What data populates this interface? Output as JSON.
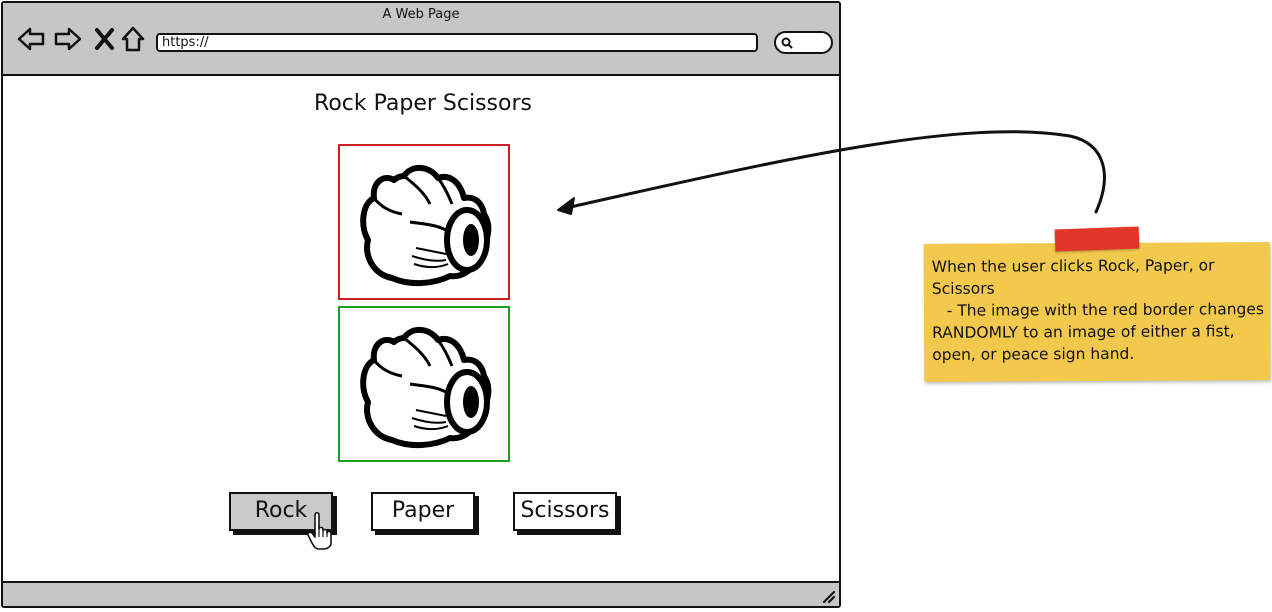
{
  "browser": {
    "window_title": "A Web Page",
    "url": "https://"
  },
  "page": {
    "title": "Rock Paper Scissors",
    "buttons": {
      "rock": "Rock",
      "paper": "Paper",
      "scissors": "Scissors"
    },
    "active_button": "rock",
    "computer_hand": "fist-icon",
    "player_hand": "fist-icon",
    "colors": {
      "computer_border": "#cc1f1f",
      "player_border": "#1aa01a"
    }
  },
  "annotation": {
    "note": "When the user clicks Rock, Paper, or Scissors\n   - The image with the red border changes RANDOMLY to an image of either a fist, open, or peace sign hand.",
    "note_color": "#f2c94c",
    "tape_color": "#e2362a"
  }
}
